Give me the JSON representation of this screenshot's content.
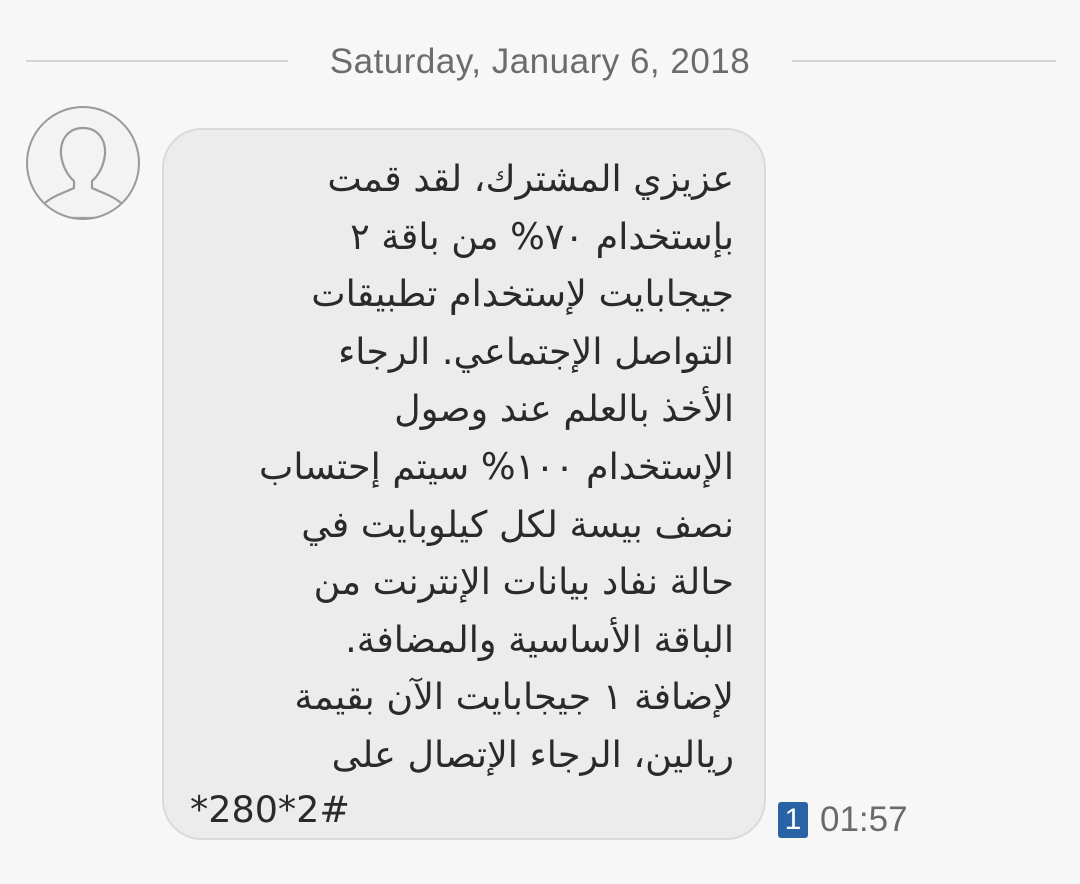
{
  "conversation": {
    "date_separator": "Saturday, January 6, 2018"
  },
  "message": {
    "avatar_icon": "person-silhouette-icon",
    "body": "عزيزي المشترك، لقد قمت\nبإستخدام ٧٠% من باقة ٢\nجيجابايت لإستخدام تطبيقات\nالتواصل الإجتماعي. الرجاء\nالأخذ بالعلم عند وصول\nالإستخدام ١٠٠% سيتم إحتساب\nنصف بيسة لكل كيلوبايت في\nحالة نفاد بيانات الإنترنت من\nالباقة الأساسية والمضافة.\nلإضافة ١ جيجابايت الآن بقيمة\nريالين، الرجاء الإتصال على",
    "code": "*280*2#",
    "sim_slot": "1",
    "time": "01:57",
    "sim_badge_color": "#2a62a6",
    "bubble_color": "#ececec"
  }
}
